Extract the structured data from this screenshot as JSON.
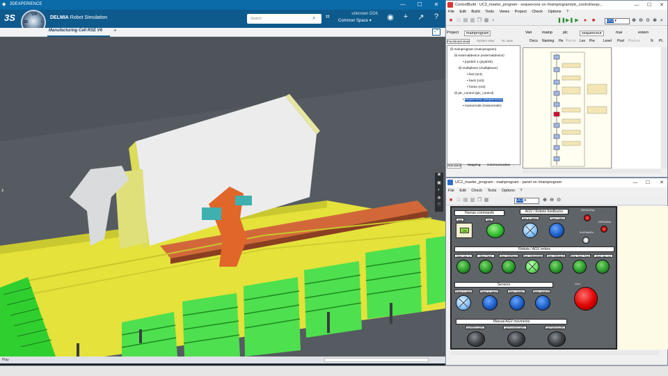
{
  "tdx": {
    "window_title": "3DEXPERIENCE",
    "app_brand": "DELMIA",
    "app_name": "Robot Simulation",
    "search_placeholder": "Search",
    "user": "unknown DD6",
    "space": "Common Space",
    "tab": "Manufacturing Cell RSE V6",
    "tab_add": "+",
    "status": "Play",
    "compass": {
      "n": "V.R",
      "w": "3D",
      "e": "i",
      "s": "⌂"
    }
  },
  "cb": {
    "title": "ControlBuild - UC2_master_program - sequenceur on /mainprogram/plc_control/sequ...",
    "menu": [
      "File",
      "Edit",
      "Build",
      "Tools",
      "Views",
      "Project",
      "Check",
      "Options",
      "?"
    ],
    "combo": "UC2",
    "tabs_left": [
      "Project",
      "mainprogram"
    ],
    "tabs_doc": [
      "Vari",
      "mainp",
      "plc",
      "sequenceur",
      "mai",
      "extern"
    ],
    "sub_tabs_left": [
      "Functional view",
      "System view",
      "HL view"
    ],
    "sub_tabs_doc": [
      "Docu",
      "Naming",
      "He",
      "Pre-co",
      "Les",
      "Pre",
      "Level",
      "Post",
      "Post-co",
      "N",
      "PL"
    ],
    "bottom_tabs": [
      "Standard",
      "Mapping",
      "Communication"
    ],
    "tree": [
      {
        "text": "mainprogram (mainprogram)",
        "level": 0
      },
      {
        "text": "externaldevice (externaldevice)",
        "level": 1
      },
      {
        "text": "joystick 1 (joystick)",
        "level": 2
      },
      {
        "text": "multiplexer (multiplexer)",
        "level": 2
      },
      {
        "text": "fwd (or3)",
        "level": 3
      },
      {
        "text": "back (or3)",
        "level": 3
      },
      {
        "text": "home (or3)",
        "level": 3
      },
      {
        "text": "plc_control (plc_control)",
        "level": 1
      },
      {
        "text": "sequenceur (sequenceur)",
        "level": 2
      },
      {
        "text": "manumode (manumode)",
        "level": 2
      }
    ]
  },
  "pn": {
    "title": "UC2_master_program - mainprogram - panel on /mainprogram",
    "menu": [
      "File",
      "Edit",
      "Check",
      "Tools",
      "Options",
      "?"
    ],
    "combo": "UC2",
    "groups": {
      "human": "Human commands",
      "feedback": "AGV / Robots feedbacks",
      "orders": "Robots / AGV orders",
      "sensors": "Sensors",
      "manual": "Manual AGV movments"
    },
    "human_buttons": [
      "Auto",
      "Start"
    ],
    "auto_value": "ON",
    "feedback_buttons": [
      "Agv_in_station",
      "Panel_Drilled"
    ],
    "leds": [
      "ERRAGVReq",
      "ERRRobReq",
      "ErrARobotRst"
    ],
    "order_buttons": [
      "Move_Agv_in",
      "Bring_Panel",
      "Start_Drill(Right)",
      "Start_DrillingMiddle",
      "Start_DrillingLeft",
      "Bring_Back_Panel",
      "Move_Agv_out"
    ],
    "sensor_buttons": [
      "Frame_in_place",
      "Frame_in_place2",
      "Beam_created",
      "Beam_created2"
    ],
    "error_label": "Error",
    "manual_buttons": [
      "agvRBManualRp",
      "agvHomeManualRp",
      "agvFwdManualRp"
    ]
  }
}
